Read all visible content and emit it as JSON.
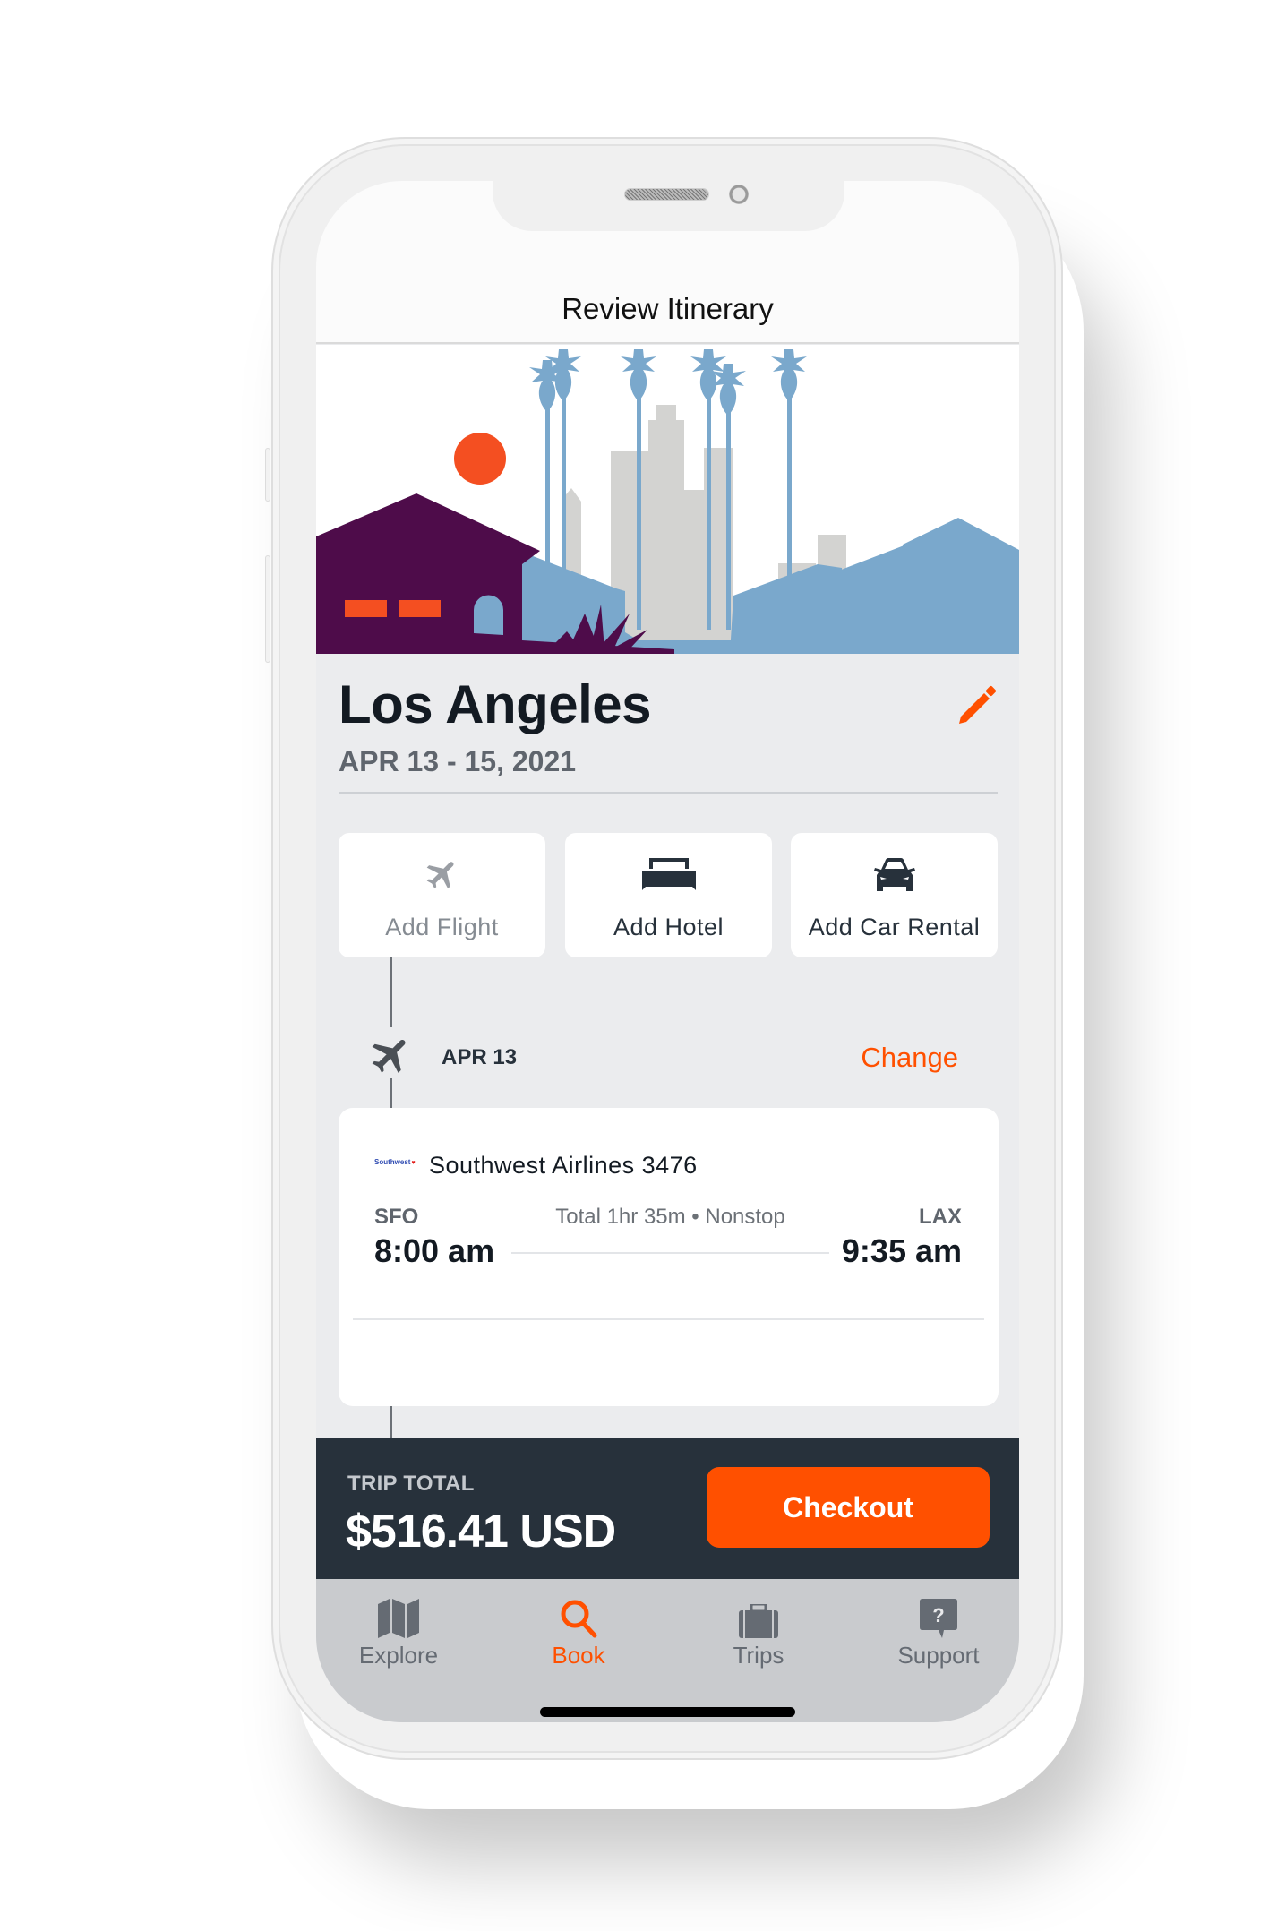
{
  "header": {
    "title": "Review Itinerary"
  },
  "hero": {
    "illustration": "los-angeles-skyline",
    "colors": {
      "sun": "#f44f21",
      "house": "#4e0c4a",
      "windows": "#f44f21",
      "hills": "#7aa8cc",
      "buildings": "#d3d3d1",
      "palms": "#7aa8cc"
    }
  },
  "trip": {
    "city": "Los Angeles",
    "dates": "APR 13 - 15, 2021",
    "edit_icon": "pencil-icon"
  },
  "add_options": [
    {
      "label": "Add Flight",
      "icon": "airplane-icon",
      "state": "disabled"
    },
    {
      "label": "Add Hotel",
      "icon": "bed-icon",
      "state": "enabled"
    },
    {
      "label": "Add Car Rental",
      "icon": "car-icon",
      "state": "enabled"
    }
  ],
  "segment": {
    "icon": "airplane-icon",
    "date": "APR 13",
    "change_label": "Change",
    "flight": {
      "airline_logo_text": "Southwest",
      "airline": "Southwest Airlines 3476",
      "origin": "SFO",
      "destination": "LAX",
      "summary": "Total 1hr 35m • Nonstop",
      "depart_time": "8:00 am",
      "arrive_time": "9:35 am"
    }
  },
  "footer": {
    "total_label": "TRIP TOTAL",
    "total_value": "$516.41 USD",
    "checkout_label": "Checkout"
  },
  "tabs": [
    {
      "label": "Explore",
      "icon": "map-icon",
      "active": false
    },
    {
      "label": "Book",
      "icon": "search-icon",
      "active": true
    },
    {
      "label": "Trips",
      "icon": "suitcase-icon",
      "active": false
    },
    {
      "label": "Support",
      "icon": "help-bubble-icon",
      "active": false
    }
  ],
  "colors": {
    "accent": "#ff5000",
    "dark": "#27313b",
    "background": "#ebecee",
    "tabbar": "#c9cbce"
  }
}
